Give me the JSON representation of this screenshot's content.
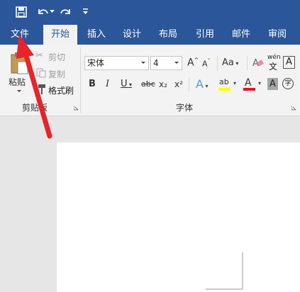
{
  "title_bar": {
    "qa_icons": [
      "save-icon",
      "undo-icon",
      "undo-dropdown-icon",
      "redo-icon",
      "customize-qat-icon"
    ]
  },
  "tabs": [
    {
      "label": "文件"
    },
    {
      "label": "开始"
    },
    {
      "label": "插入"
    },
    {
      "label": "设计"
    },
    {
      "label": "布局"
    },
    {
      "label": "引用"
    },
    {
      "label": "邮件"
    },
    {
      "label": "审阅"
    }
  ],
  "clipboard": {
    "paste_label": "粘贴",
    "cut_label": "剪切",
    "copy_label": "复制",
    "format_painter_label": "格式刷",
    "group_label": "剪贴板"
  },
  "font": {
    "font_name": "宋体",
    "font_size": "4",
    "group_label": "字体",
    "bold": "B",
    "italic": "I",
    "underline": "U",
    "strike": "abc",
    "subscript": "x₂",
    "superscript": "x²",
    "grow": "A",
    "shrink": "A",
    "case": "Aa",
    "phonetic": "wén",
    "border_char": "A",
    "text_effect": "A",
    "highlight": "ab",
    "font_color": "A",
    "shading": "A",
    "enclose": "字"
  },
  "colors": {
    "brand": "#2b579a",
    "highlight_bar": "#ffff00",
    "font_color_bar": "#e81123",
    "arrow": "#e8232a"
  }
}
